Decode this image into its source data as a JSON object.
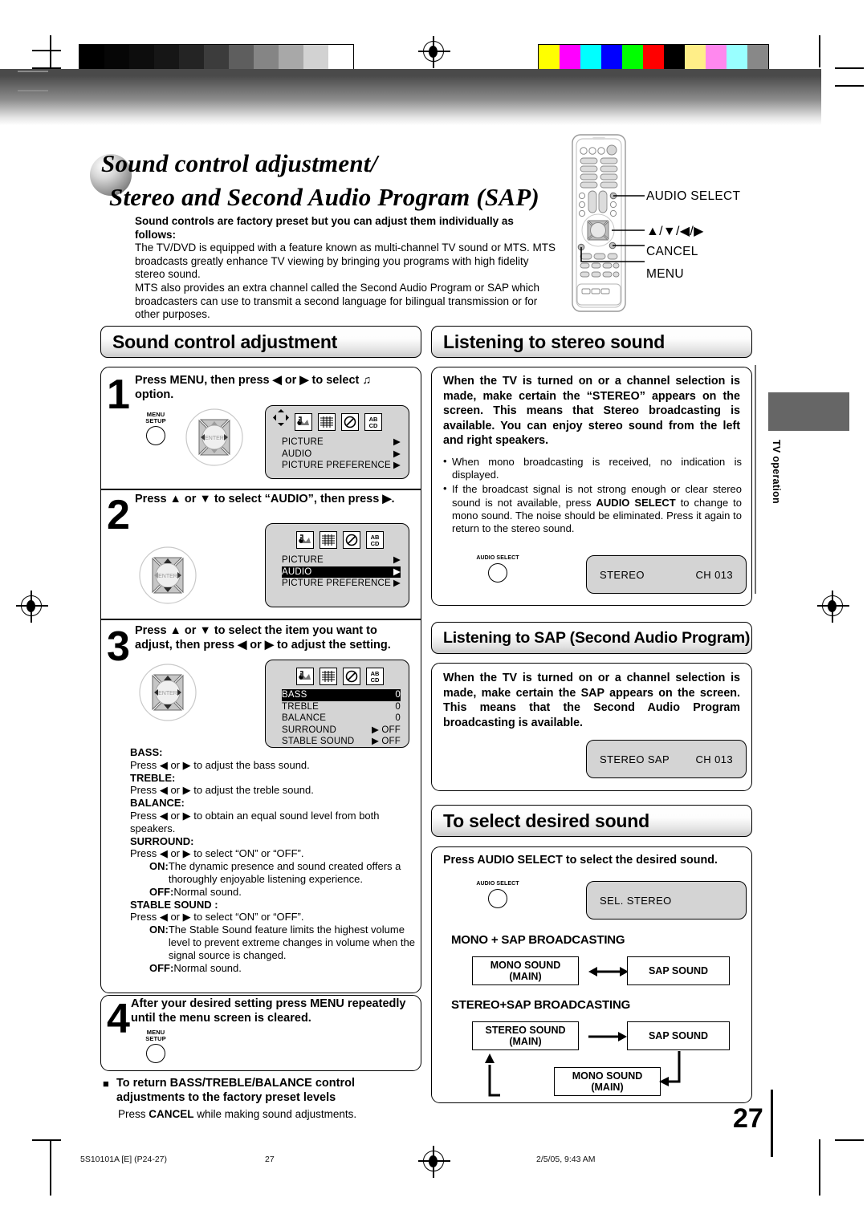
{
  "page": {
    "number": "27",
    "title_line1": "Sound control adjustment/",
    "title_line2": "Stereo and Second Audio Program (SAP)",
    "side_tab_label": "TV operation"
  },
  "intro": {
    "lead": "Sound controls are factory preset but you can adjust them individually as follows:",
    "body": "The TV/DVD is equipped with a feature known as multi-channel TV sound or MTS. MTS broadcasts greatly enhance TV viewing by bringing you programs with high fidelity stereo sound.",
    "body2": "MTS also provides an extra channel called the Second Audio Program or SAP which broadcasters can use to transmit a second language for bilingual transmission or for other purposes."
  },
  "remote": {
    "callout_audio_select": "AUDIO SELECT",
    "callout_arrows": "▲/▼/◀/▶",
    "callout_cancel": "CANCEL",
    "callout_menu": "MENU"
  },
  "sections": {
    "sound_control": "Sound control adjustment",
    "listening_stereo": "Listening to stereo sound",
    "listening_sap": "Listening to SAP (Second Audio Program)",
    "select_sound": "To select desired sound"
  },
  "steps": [
    {
      "num": "1",
      "text": "Press MENU, then press ◀ or ▶ to select ♫ option.",
      "button_line1": "MENU",
      "button_line2": "SETUP"
    },
    {
      "num": "2",
      "text": "Press ▲ or ▼ to select “AUDIO”, then press ▶."
    },
    {
      "num": "3",
      "text": "Press ▲ or ▼ to select the item you want to adjust, then press ◀ or ▶ to adjust the setting."
    },
    {
      "num": "4",
      "text": "After your desired setting press MENU repeatedly until the menu screen is cleared.",
      "button_line1": "MENU",
      "button_line2": "SETUP"
    }
  ],
  "osd_main": {
    "rows": [
      {
        "label": "PICTURE",
        "value": "▶",
        "highlight": false
      },
      {
        "label": "AUDIO",
        "value": "▶",
        "highlight": false
      },
      {
        "label": "PICTURE  PREFERENCE",
        "value": "▶",
        "highlight": false
      }
    ]
  },
  "osd_audio_selected": {
    "rows": [
      {
        "label": "PICTURE",
        "value": "▶",
        "highlight": false
      },
      {
        "label": "AUDIO",
        "value": "▶",
        "highlight": true
      },
      {
        "label": "PICTURE  PREFERENCE",
        "value": "▶",
        "highlight": false
      }
    ]
  },
  "osd_audio_menu": {
    "rows": [
      {
        "label": "BASS",
        "value": "0",
        "highlight": true
      },
      {
        "label": "TREBLE",
        "value": "0",
        "highlight": false
      },
      {
        "label": "BALANCE",
        "value": "0",
        "highlight": false
      },
      {
        "label": "SURROUND",
        "value": "▶ OFF",
        "highlight": false
      },
      {
        "label": "STABLE SOUND",
        "value": "▶ OFF",
        "highlight": false
      }
    ]
  },
  "osd_icons": [
    "audio-icon",
    "grid-icon",
    "prohibit-icon",
    "abcd-icon"
  ],
  "enter_label": "ENTER",
  "adjust_items": [
    {
      "head": "BASS:",
      "desc": "Press ◀ or ▶ to adjust the bass sound."
    },
    {
      "head": "TREBLE:",
      "desc": "Press ◀ or ▶ to adjust the treble sound."
    },
    {
      "head": "BALANCE:",
      "desc": "Press ◀ or ▶ to obtain an equal sound level from both speakers."
    },
    {
      "head": "SURROUND:",
      "desc": "Press ◀ or ▶ to select “ON” or “OFF”."
    }
  ],
  "surround_on_label": "ON:",
  "surround_on_text": "The dynamic presence and sound created offers a thoroughly enjoyable listening experience.",
  "surround_off_label": "OFF:",
  "surround_off_text": "Normal sound.",
  "stable_head": "STABLE SOUND :",
  "stable_press": "Press ◀ or ▶ to select “ON” or “OFF”.",
  "stable_on_label": "ON:",
  "stable_on_text": "The Stable Sound feature limits the highest volume level to prevent extreme changes in volume when the signal source is changed.",
  "stable_off_label": "OFF:",
  "stable_off_text": "Normal sound.",
  "reset_note": {
    "heading": "To return BASS/TREBLE/BALANCE control adjustments to the factory preset levels",
    "body_pre": "Press ",
    "body_bold": "CANCEL",
    "body_post": " while making sound adjustments."
  },
  "stereo_section": {
    "bold": "When the TV is turned on or a channel selection is made, make certain the “STEREO” appears on the screen. This means that Stereo broadcasting is available. You can enjoy stereo sound from the left and right speakers.",
    "bullets": [
      "When mono broadcasting is received, no indication is displayed.",
      "If the broadcast signal is not strong enough or clear stereo sound is not available, press AUDIO SELECT to change to mono sound. The noise should be eliminated. Press it again to return to the stereo sound."
    ],
    "bullet2_bold": "AUDIO SELECT",
    "button_label": "AUDIO SELECT",
    "display_left": "STEREO",
    "display_right": "CH 013"
  },
  "sap_section": {
    "bold": "When the TV is turned on or a channel selection is made, make certain the SAP appears on the screen. This means that the Second Audio Program broadcasting is available.",
    "display_left": "STEREO  SAP",
    "display_right": "CH 013"
  },
  "select_sound_section": {
    "instruction_pre": "Press ",
    "instruction_bold": "AUDIO SELECT",
    "instruction_post": " to select the desired sound.",
    "button_label": "AUDIO SELECT",
    "display_label": "SEL. STEREO",
    "mono_sap_caption": "MONO + SAP BROADCASTING",
    "stereo_sap_caption": "STEREO+SAP BROADCASTING",
    "box_mono_l1": "MONO SOUND",
    "box_mono_l2": "(MAIN)",
    "box_sap": "SAP SOUND",
    "box_stereo_l1": "STEREO SOUND",
    "box_stereo_l2": "(MAIN)"
  },
  "footer": {
    "left": "5S10101A [E] (P24-27)",
    "center": "27",
    "right": "2/5/05, 9:43 AM"
  },
  "calibration": {
    "gray": [
      "#000000",
      "#060606",
      "#0d0d0d",
      "#161616",
      "#242424",
      "#3c3c3c",
      "#5e5e5e",
      "#858585",
      "#a8a8a8",
      "#d2d2d2",
      "#ffffff"
    ],
    "color": [
      "#ffff00",
      "#ff00ff",
      "#00ffff",
      "#0000ff",
      "#00ff00",
      "#ff0000",
      "#000000",
      "#ffee88",
      "#ff88ee",
      "#99ffff",
      "#888888"
    ]
  }
}
